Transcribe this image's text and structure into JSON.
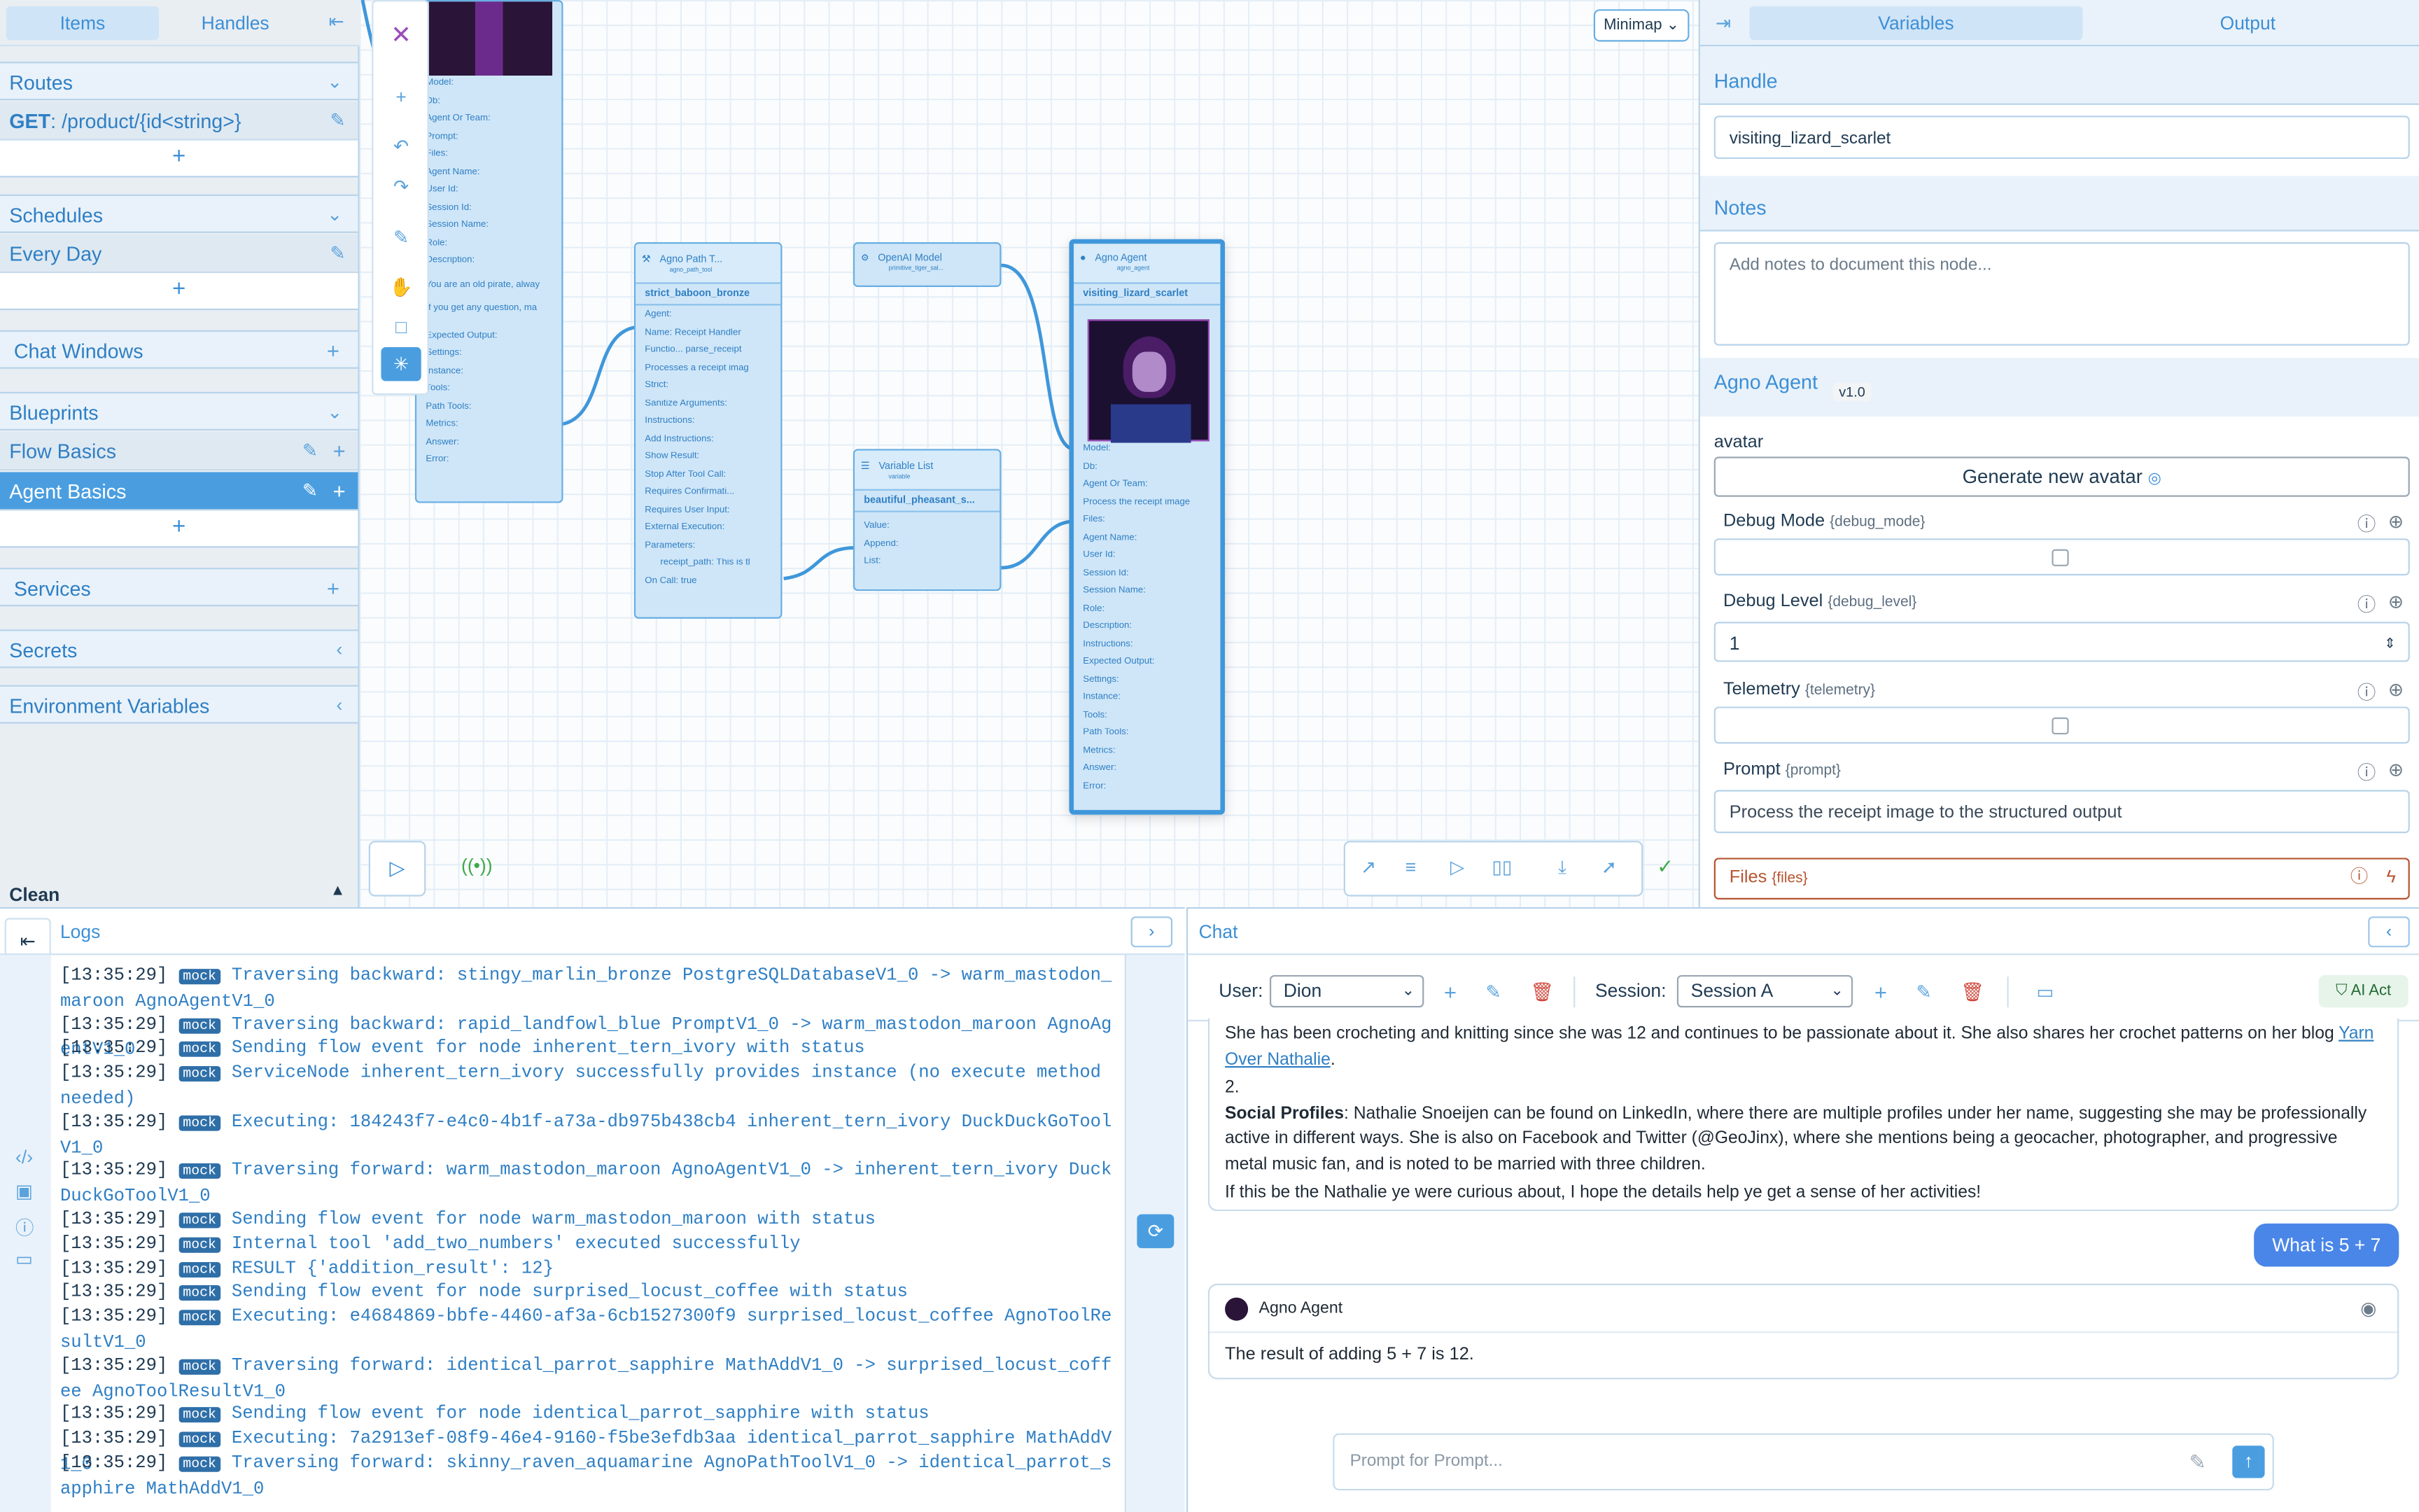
{
  "sidebar": {
    "tabs": {
      "items": "Items",
      "handles": "Handles"
    },
    "routes": {
      "title": "Routes",
      "item_method": "GET",
      "item_path": ": /product/{id<string>}"
    },
    "schedules": {
      "title": "Schedules",
      "item": "Every Day"
    },
    "chat_windows": {
      "title": "Chat Windows"
    },
    "blueprints": {
      "title": "Blueprints",
      "items": [
        "Flow Basics",
        "Agent Basics"
      ]
    },
    "services": {
      "title": "Services"
    },
    "secrets": {
      "title": "Secrets"
    },
    "env": {
      "title": "Environment Variables"
    },
    "status": "Clean"
  },
  "canvas": {
    "minimap": "Minimap",
    "node_left": {
      "fields": [
        "Model:",
        "Db:",
        "Agent Or Team:",
        "Prompt:",
        "Files:",
        "Agent Name:",
        "User Id:",
        "Session Id:",
        "Session Name:",
        "Role:",
        "Description:",
        "You are an old pirate, alway",
        "If you get any question, ma",
        "Expected Output:",
        "Settings:",
        "Instance:",
        "Tools:",
        "Path Tools:",
        "Metrics:",
        "Answer:",
        "Error:"
      ]
    },
    "node_path": {
      "title": "Agno Path T...",
      "subtitle": "agno_path_tool",
      "name": "strict_baboon_bronze",
      "fields": [
        "Agent:",
        "Name: Receipt Handler",
        "Functio... parse_receipt",
        "Processes a receipt imag",
        "Strict:",
        "Sanitize Arguments:",
        "Instructions:",
        "Add Instructions:",
        "Show Result:",
        "Stop After Tool Call:",
        "Requires Confirmati...",
        "Requires User Input:",
        "External Execution:",
        "Parameters:",
        "receipt_path: This is tl",
        "On Call: true"
      ]
    },
    "node_openai": {
      "title": "OpenAI Model",
      "subtitle": "primitive_tiger_sal..."
    },
    "node_var": {
      "title": "Variable List",
      "subtitle": "variable",
      "name": "beautiful_pheasant_s...",
      "fields": [
        "Value:",
        "Append:",
        "List:"
      ]
    },
    "node_agent": {
      "title": "Agno Agent",
      "subtitle": "agno_agent",
      "name": "visiting_lizard_scarlet",
      "fields": [
        "Model:",
        "Db:",
        "Agent Or Team:",
        "Process the receipt image",
        "Files:",
        "Agent Name:",
        "User Id:",
        "Session Id:",
        "Session Name:",
        "Role:",
        "Description:",
        "Instructions:",
        "Expected Output:",
        "Settings:",
        "Instance:",
        "Tools:",
        "Path Tools:",
        "Metrics:",
        "Answer:",
        "Error:"
      ]
    }
  },
  "right_panel": {
    "tabs": {
      "variables": "Variables",
      "output": "Output"
    },
    "handle_label": "Handle",
    "handle_value": "visiting_lizard_scarlet",
    "notes_label": "Notes",
    "notes_placeholder": "Add notes to document this node...",
    "agent_title": "Agno Agent",
    "agent_version": "v1.0",
    "avatar_label": "avatar",
    "generate_avatar": "Generate new avatar",
    "debug_mode": {
      "label": "Debug Mode",
      "key": "{debug_mode}"
    },
    "debug_level": {
      "label": "Debug Level",
      "key": "{debug_level}",
      "value": "1"
    },
    "telemetry": {
      "label": "Telemetry",
      "key": "{telemetry}"
    },
    "prompt": {
      "label": "Prompt",
      "key": "{prompt}",
      "value": "Process the receipt image to the structured output"
    },
    "files": {
      "label": "Files",
      "key": "{files}"
    }
  },
  "logs": {
    "title": "Logs",
    "badge": "mock",
    "lines": [
      {
        "ts": "[13:35:29]",
        "text": "Traversing backward: stingy_marlin_bronze PostgreSQLDatabaseV1_0 -> warm_mastodon_maroon AgnoAgentV1_0"
      },
      {
        "ts": "[13:35:29]",
        "text": "Traversing backward: rapid_landfowl_blue PromptV1_0 -> warm_mastodon_maroon AgnoAgentV1_0"
      },
      {
        "ts": "[13:35:29]",
        "text": "Sending flow event for node inherent_tern_ivory with status"
      },
      {
        "ts": "[13:35:29]",
        "text": "ServiceNode inherent_tern_ivory successfully provides instance (no execute method needed)"
      },
      {
        "ts": "[13:35:29]",
        "text": "Executing: 184243f7-e4c0-4b1f-a73a-db975b438cb4 inherent_tern_ivory DuckDuckGoToolV1_0"
      },
      {
        "ts": "[13:35:29]",
        "text": "Traversing forward: warm_mastodon_maroon AgnoAgentV1_0 -> inherent_tern_ivory DuckDuckGoToolV1_0"
      },
      {
        "ts": "[13:35:29]",
        "text": "Sending flow event for node warm_mastodon_maroon with status"
      },
      {
        "ts": "[13:35:29]",
        "text": "Internal tool 'add_two_numbers' executed successfully"
      },
      {
        "ts": "[13:35:29]",
        "text": "RESULT {'addition_result': 12}"
      },
      {
        "ts": "[13:35:29]",
        "text": "Sending flow event for node surprised_locust_coffee with status"
      },
      {
        "ts": "[13:35:29]",
        "text": "Executing: e4684869-bbfe-4460-af3a-6cb1527300f9 surprised_locust_coffee AgnoToolResultV1_0"
      },
      {
        "ts": "[13:35:29]",
        "text": "Traversing forward: identical_parrot_sapphire MathAddV1_0 -> surprised_locust_coffee AgnoToolResultV1_0"
      },
      {
        "ts": "[13:35:29]",
        "text": "Sending flow event for node identical_parrot_sapphire with status"
      },
      {
        "ts": "[13:35:29]",
        "text": "Executing: 7a2913ef-08f9-46e4-9160-f5be3efdb3aa identical_parrot_sapphire MathAddV1_0"
      },
      {
        "ts": "[13:35:29]",
        "text": "Traversing forward: skinny_raven_aquamarine AgnoPathToolV1_0 -> identical_parrot_sapphire MathAddV1_0"
      }
    ]
  },
  "chat": {
    "title": "Chat",
    "user_label": "User:",
    "user_value": "Dion",
    "session_label": "Session:",
    "session_value": "Session A",
    "ai_act": "AI Act",
    "msg1_p1": "She has been crocheting and knitting since she was 12 and continues to be passionate about it. She also shares her crochet patterns on her blog ",
    "msg1_link": "Yarn Over Nathalie",
    "msg1_p1_end": ".",
    "msg1_num": "2.",
    "msg1_bold": "Social Profiles",
    "msg1_p2": ": Nathalie Snoeijen can be found on LinkedIn, where there are multiple profiles under her name, suggesting she may be professionally active in different ways. She is also on Facebook and Twitter (@GeoJinx), where she mentions being a geocacher, photographer, and progressive metal music fan, and is noted to be married with three children.",
    "msg1_p3": "If this be the Nathalie ye were curious about, I hope the details help ye get a sense of her activities!",
    "user_msg": "What is 5 + 7",
    "agent_name": "Agno Agent",
    "agent_reply": "The result of adding 5 + 7 is 12.",
    "prompt_placeholder": "Prompt for Prompt..."
  }
}
